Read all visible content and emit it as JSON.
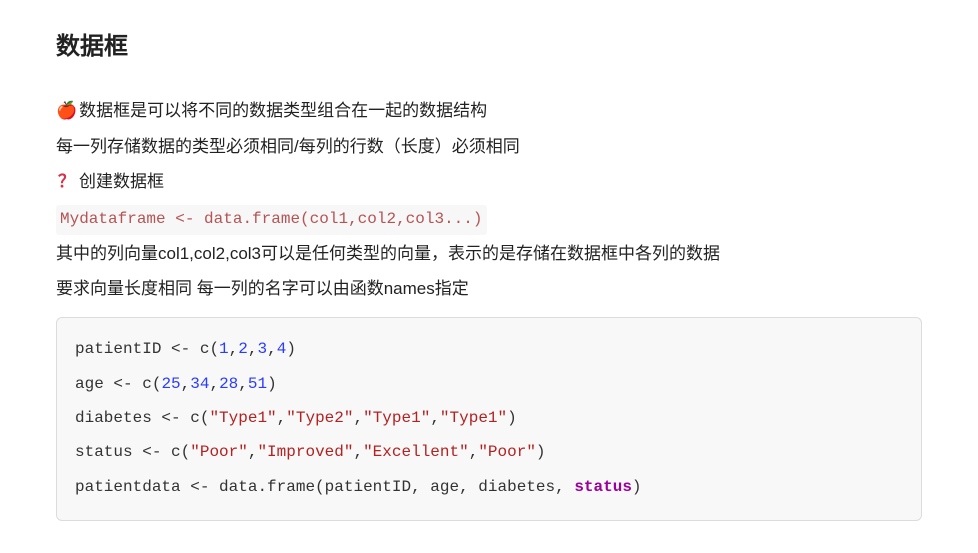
{
  "heading": "数据框",
  "intro": {
    "apple_icon": "🍎",
    "line1": "数据框是可以将不同的数据类型组合在一起的数据结构",
    "line2": "每一列存储数据的类型必须相同/每列的行数（长度）必须相同",
    "qmark": "？",
    "line3": "创建数据框"
  },
  "inline_code": {
    "lhs": "Mydataframe",
    "arrow": " <- ",
    "fn": "data.frame",
    "open": "(",
    "args": "col1,col2,col3...",
    "close": ")"
  },
  "after_code": {
    "line1": "其中的列向量col1,col2,col3可以是任何类型的向量，表示的是存储在数据框中各列的数据",
    "line2": "要求向量长度相同 每一列的名字可以由函数names指定"
  },
  "block": {
    "l1": {
      "var": "patientID",
      "arrow": " <- ",
      "fn": "c",
      "open": "(",
      "n1": "1",
      "c1": ",",
      "n2": "2",
      "c2": ",",
      "n3": "3",
      "c3": ",",
      "n4": "4",
      "close": ")"
    },
    "l2": {
      "var": "age",
      "arrow": " <- ",
      "fn": "c",
      "open": "(",
      "n1": "25",
      "c1": ",",
      "n2": "34",
      "c2": ",",
      "n3": "28",
      "c3": ",",
      "n4": "51",
      "close": ")"
    },
    "l3": {
      "var": "diabetes",
      "arrow": " <- ",
      "fn": "c",
      "open": "(",
      "s1": "\"Type1\"",
      "c1": ",",
      "s2": "\"Type2\"",
      "c2": ",",
      "s3": "\"Type1\"",
      "c3": ",",
      "s4": "\"Type1\"",
      "close": ")"
    },
    "l4": {
      "var": "status",
      "arrow": " <- ",
      "fn": "c",
      "open": "(",
      "s1": "\"Poor\"",
      "c1": ",",
      "s2": "\"Improved\"",
      "c2": ",",
      "s3": "\"Excellent\"",
      "c3": ",",
      "s4": "\"Poor\"",
      "close": ")"
    },
    "l5": {
      "var": "patientdata",
      "arrow": " <- ",
      "fn": "data.frame",
      "open": "(",
      "a1": "patientID",
      "c1": ", ",
      "a2": "age",
      "c2": ", ",
      "a3": "diabetes",
      "c3": ", ",
      "a4": "status",
      "close": ")"
    }
  }
}
